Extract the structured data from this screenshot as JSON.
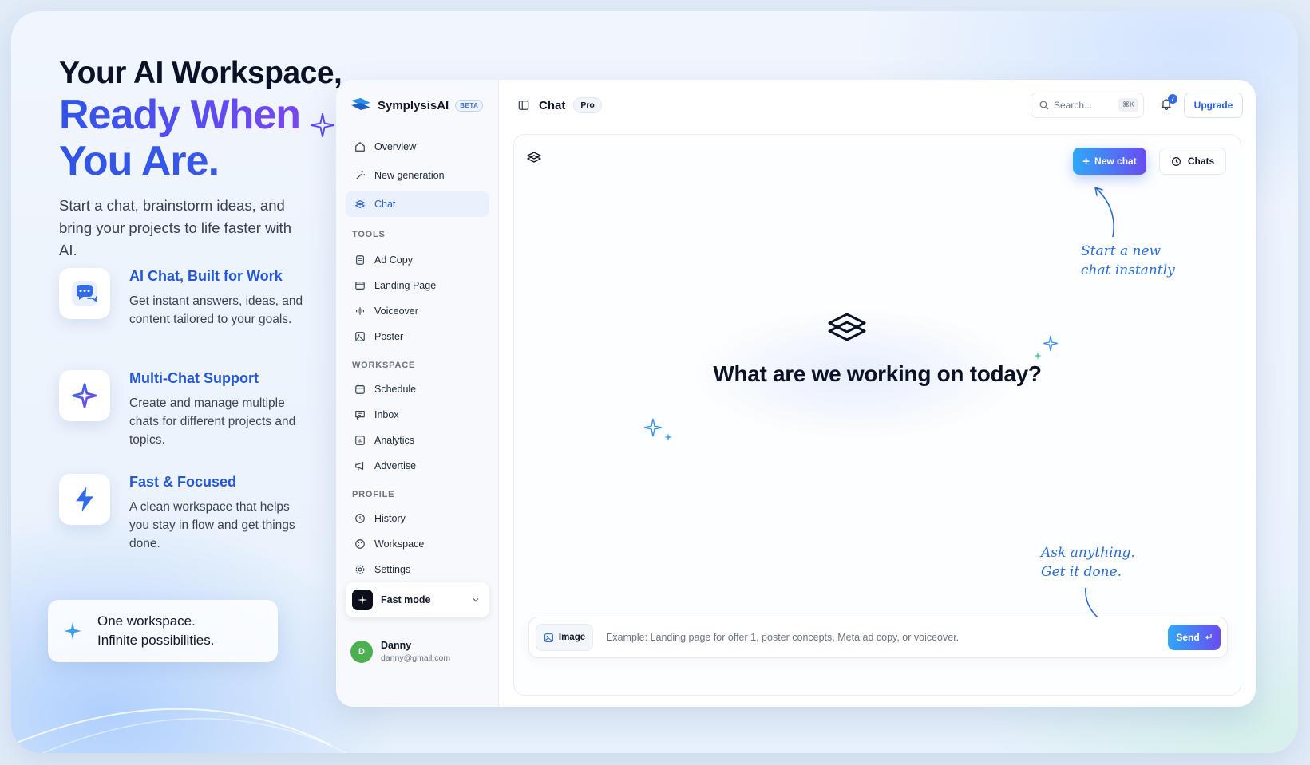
{
  "hero": {
    "title_line1": "Your AI Workspace,",
    "title_line2": "Ready When",
    "title_line3": "You Are.",
    "subtitle": "Start a chat, brainstorm ideas, and bring your projects to life faster with AI."
  },
  "features": [
    {
      "title": "AI Chat, Built for Work",
      "desc": "Get instant answers, ideas, and content tailored to your goals.",
      "icon": "chat-bubbles-icon"
    },
    {
      "title": "Multi-Chat Support",
      "desc": "Create and manage multiple chats for different projects and topics.",
      "icon": "sparkle-icon"
    },
    {
      "title": "Fast & Focused",
      "desc": "A clean workspace that helps you stay in flow and get things done.",
      "icon": "lightning-icon"
    }
  ],
  "cta": {
    "line1": "One workspace.",
    "line2": "Infinite possibilities."
  },
  "app": {
    "brand": "SymplysisAI",
    "beta": "BETA",
    "nav_main": [
      "Overview",
      "New generation",
      "Chat"
    ],
    "tools_label": "TOOLS",
    "tools": [
      "Ad Copy",
      "Landing Page",
      "Voiceover",
      "Poster"
    ],
    "workspace_label": "WORKSPACE",
    "workspace": [
      "Schedule",
      "Inbox",
      "Analytics",
      "Advertise"
    ],
    "profile_label": "PROFILE",
    "profile": [
      "History",
      "Workspace",
      "Settings"
    ],
    "mode": "Fast mode",
    "user": {
      "initial": "D",
      "name": "Danny",
      "email": "danny@gmail.com"
    },
    "topbar": {
      "title": "Chat",
      "plan": "Pro",
      "search_placeholder": "Search...",
      "search_shortcut": "⌘K",
      "notifications": "7",
      "upgrade": "Upgrade"
    },
    "panel": {
      "new_chat": "New chat",
      "chats": "Chats",
      "note_new_line1": "Start a new",
      "note_new_line2": "chat instantly",
      "headline": "What are we working on today?",
      "note_ask_line1": "Ask anything.",
      "note_ask_line2": "Get it done.",
      "image_button": "Image",
      "input_placeholder": "Example: Landing page for offer 1, poster concepts, Meta ad copy, or voiceover.",
      "send": "Send"
    }
  },
  "colors": {
    "accent": "#2a5fd8",
    "gradient_start": "#2fa8f7",
    "gradient_end": "#6a4cf0",
    "title_purple": "#5b4cf0"
  }
}
